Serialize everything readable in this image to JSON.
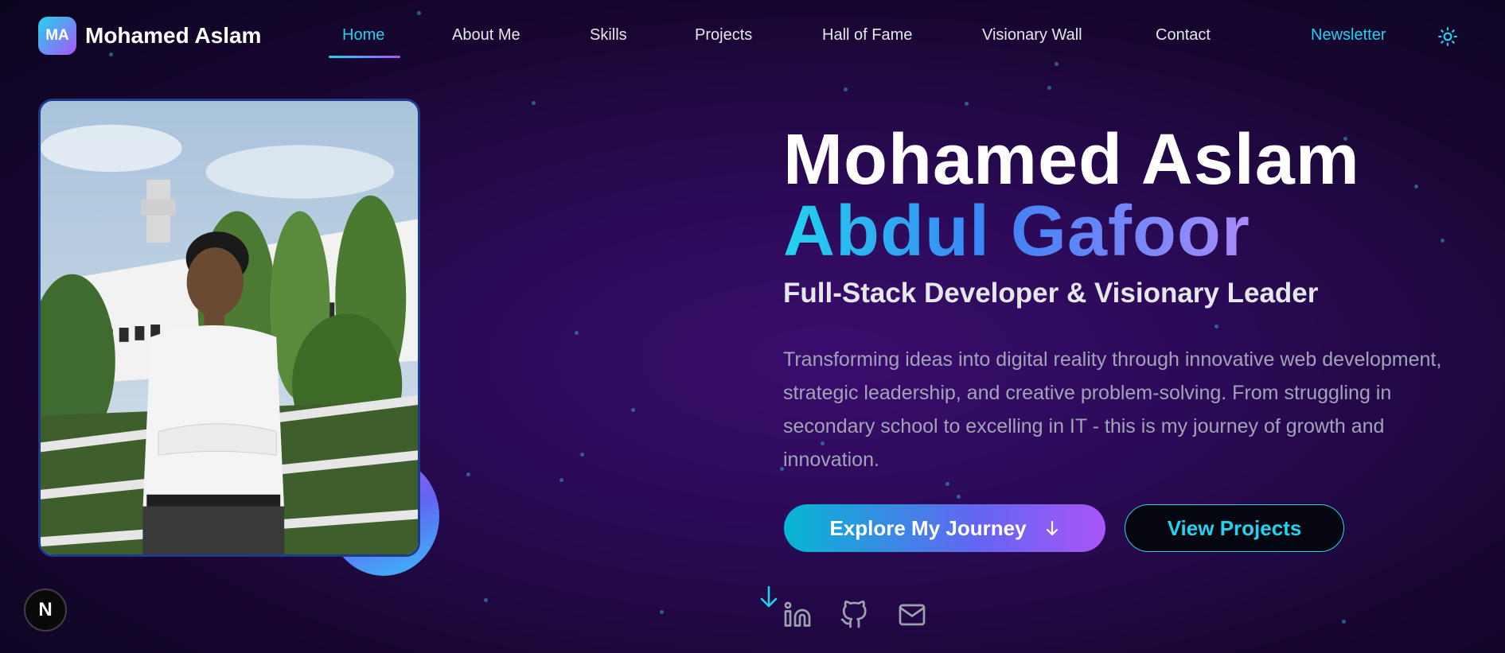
{
  "brand": {
    "initials": "MA",
    "name": "Mohamed Aslam"
  },
  "nav": {
    "links": [
      "Home",
      "About Me",
      "Skills",
      "Projects",
      "Hall of Fame",
      "Visionary Wall",
      "Contact"
    ],
    "active": "Home",
    "newsletter": "Newsletter",
    "theme_icon": "sun-icon"
  },
  "hero": {
    "title_line1": "Mohamed Aslam",
    "title_line2": "Abdul Gafoor",
    "subtitle": "Full-Stack Developer & Visionary Leader",
    "description": "Transforming ideas into digital reality through innovative web development, strategic leadership, and creative problem-solving. From struggling in secondary school to excelling in IT - this is my journey of growth and innovation.",
    "primary_button": "Explore My Journey",
    "secondary_button": "View Projects"
  },
  "social_icons": [
    "linkedin-icon",
    "github-icon",
    "mail-icon"
  ],
  "dev_badge": "N",
  "colors": {
    "accent_cyan": "#22d3ee",
    "accent_purple": "#a855f7",
    "background": "#2a0a55"
  }
}
